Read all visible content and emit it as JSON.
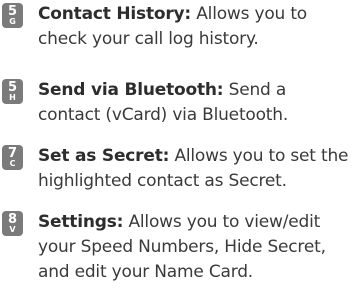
{
  "items": [
    {
      "key_digit": "5",
      "key_letter": "G",
      "term": "Contact History:",
      "description": "Allows you to check your call log history."
    },
    {
      "key_digit": "5",
      "key_letter": "H",
      "term": "Send via Bluetooth:",
      "description": "Send a contact (vCard) via Bluetooth."
    },
    {
      "key_digit": "7",
      "key_letter": "C",
      "term": "Set as Secret:",
      "description": "Allows you to set the highlighted contact as Secret."
    },
    {
      "key_digit": "8",
      "key_letter": "V",
      "term": "Settings:",
      "description": "Allows you to view/edit your Speed Numbers, Hide Secret, and edit your Name Card."
    }
  ]
}
